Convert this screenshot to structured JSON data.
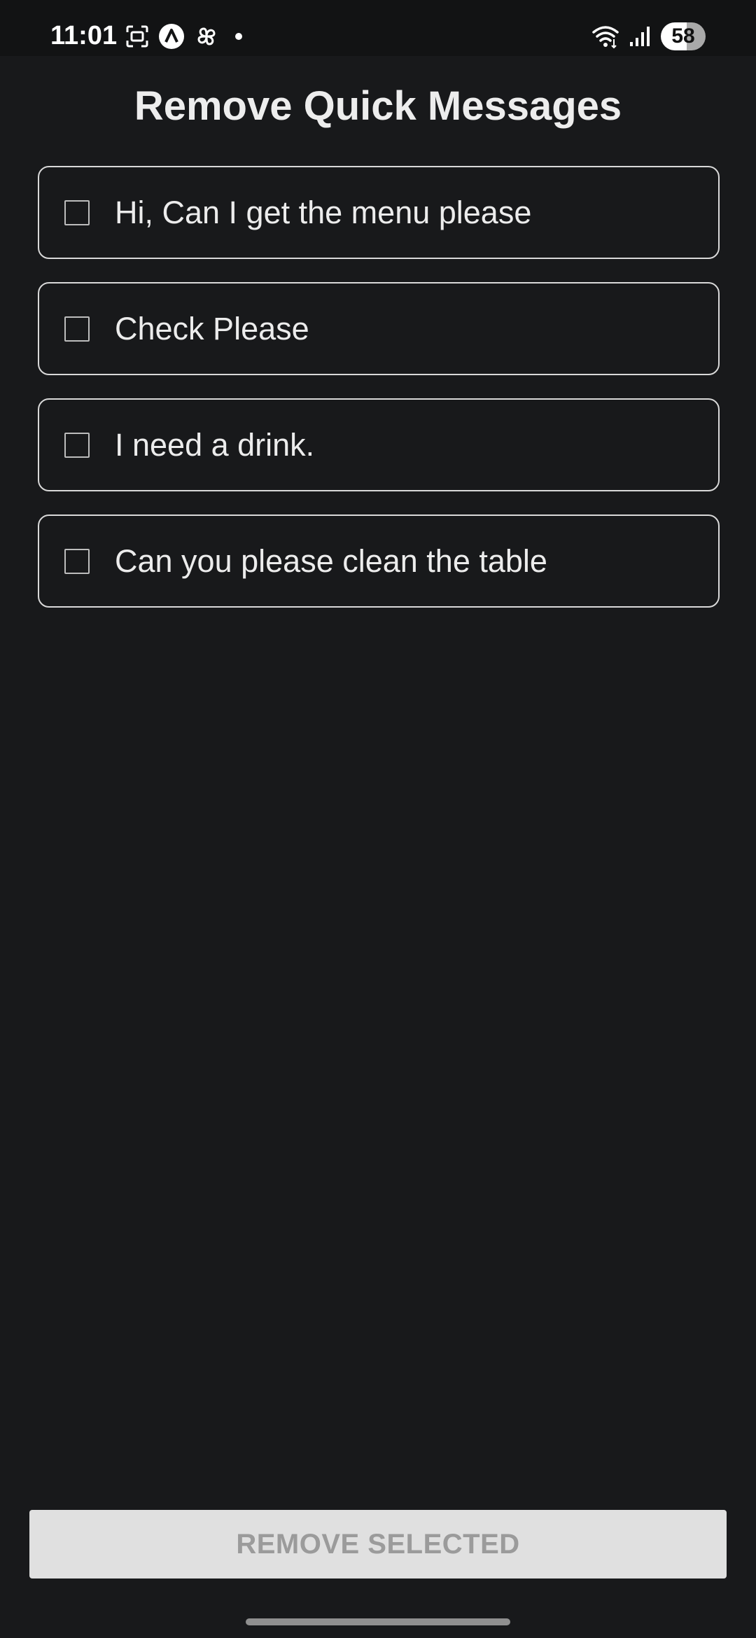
{
  "status_bar": {
    "time": "11:01",
    "battery_level": "58",
    "left_icons": [
      "screenshot-icon",
      "app-a-icon",
      "pinwheel-icon",
      "notification-dot"
    ],
    "right_icons": [
      "wifi-icon",
      "signal-icon",
      "battery-icon"
    ]
  },
  "page": {
    "title": "Remove Quick Messages"
  },
  "messages": [
    {
      "label": "Hi, Can I get the menu please",
      "checked": false
    },
    {
      "label": "Check Please",
      "checked": false
    },
    {
      "label": "I need a drink.",
      "checked": false
    },
    {
      "label": "Can you please clean the table",
      "checked": false
    }
  ],
  "actions": {
    "remove_label": "REMOVE SELECTED",
    "remove_enabled": false
  },
  "colors": {
    "background": "#18191b",
    "card_border": "#d9d9d9",
    "button_disabled_bg": "#e0e0e0",
    "button_disabled_text": "#9b9b9b"
  }
}
